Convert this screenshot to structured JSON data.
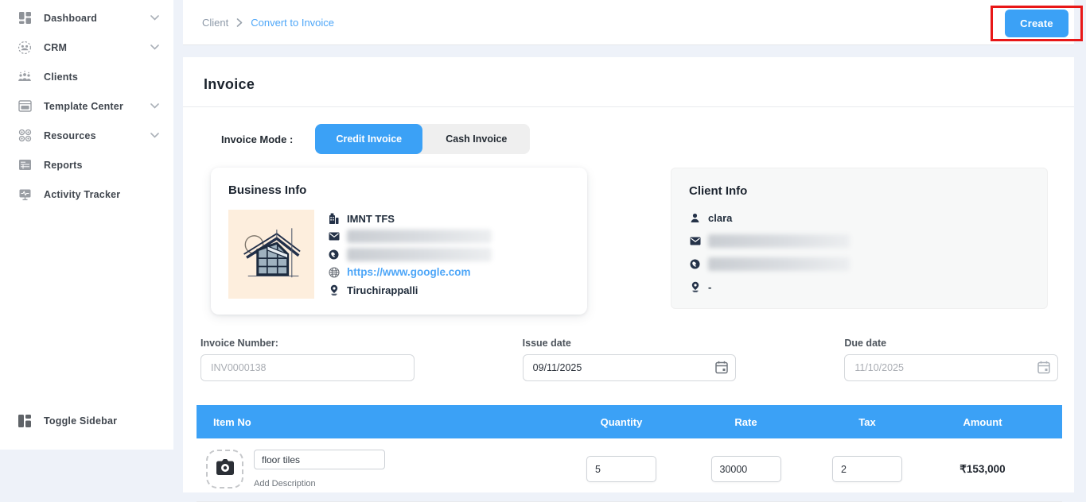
{
  "colors": {
    "accent_blue": "#3ba1f6",
    "link_blue": "#4da6f8",
    "annotation_red": "#e81717",
    "page_background": "#eef2f9",
    "logo_background": "#fdeedd"
  },
  "sidebar": {
    "items": [
      {
        "label": "Dashboard",
        "icon": "dashboard-icon",
        "has_chevron": true
      },
      {
        "label": "CRM",
        "icon": "crm-icon",
        "has_chevron": true
      },
      {
        "label": "Clients",
        "icon": "clients-icon",
        "has_chevron": false
      },
      {
        "label": "Template Center",
        "icon": "template-center-icon",
        "has_chevron": true
      },
      {
        "label": "Resources",
        "icon": "resources-icon",
        "has_chevron": true
      },
      {
        "label": "Reports",
        "icon": "reports-icon",
        "has_chevron": false
      },
      {
        "label": "Activity Tracker",
        "icon": "activity-tracker-icon",
        "has_chevron": false
      }
    ],
    "toggle_label": "Toggle Sidebar"
  },
  "topbar": {
    "breadcrumb_root": "Client",
    "breadcrumb_current": "Convert to Invoice",
    "create_button": "Create"
  },
  "invoice": {
    "title": "Invoice",
    "mode_label": "Invoice Mode :",
    "modes": [
      {
        "label": "Credit Invoice",
        "selected": true
      },
      {
        "label": "Cash Invoice",
        "selected": false
      }
    ],
    "business_info": {
      "title": "Business Info",
      "name": "IMNT TFS",
      "email_redacted": "",
      "phone_redacted": "",
      "website": "https://www.google.com",
      "location": "Tiruchirappalli"
    },
    "client_info": {
      "title": "Client Info",
      "name": "clara",
      "email_redacted": "",
      "phone_redacted": "",
      "location": "-"
    },
    "fields": {
      "invoice_number": {
        "label": "Invoice Number:",
        "placeholder": "INV0000138"
      },
      "issue_date": {
        "label": "Issue date",
        "value": "09/11/2025"
      },
      "due_date": {
        "label": "Due date",
        "value": "11/10/2025"
      }
    },
    "items_table": {
      "headers": [
        "Item No",
        "Quantity",
        "Rate",
        "Tax",
        "Amount"
      ],
      "rows": [
        {
          "item_name": "floor tiles",
          "add_description_label": "Add Description",
          "quantity": "5",
          "rate": "30000",
          "tax": "2",
          "amount": "₹153,000"
        }
      ]
    }
  }
}
